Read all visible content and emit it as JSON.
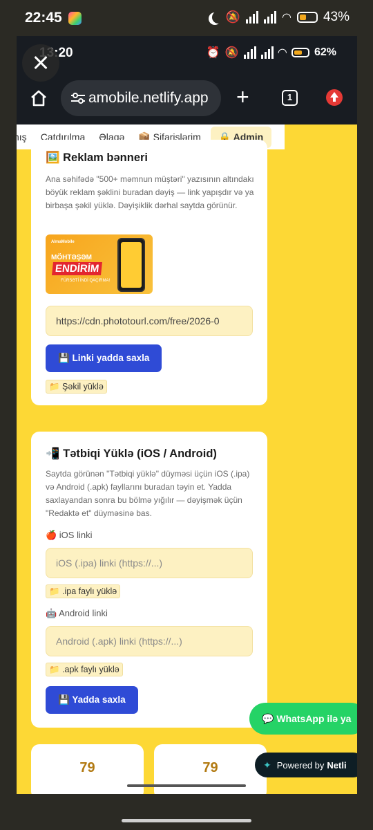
{
  "outer_status": {
    "time": "22:45",
    "battery": "43%"
  },
  "inner_status": {
    "time": "13:20",
    "battery": "62%"
  },
  "browser": {
    "url": "amobile.netlify.app",
    "tab_count": "1"
  },
  "nav": {
    "items": [
      "nış",
      "Çatdırılma",
      "Əlaqə",
      "📦 Sifarişlərim"
    ],
    "admin": "🔒 Admin"
  },
  "banner_card": {
    "title": "🖼️ Reklam bənneri",
    "description": "Ana səhifədə \"500+ məmnun müştəri\" yazısının altındakı böyük reklam şəklini buradan dəyiş — link yapışdır və ya birbaşa şəkil yüklə. Dəyişiklik dərhal saytda görünür.",
    "banner_image": {
      "brand": "AlmaMobile",
      "headline": "MÖHTƏŞƏM",
      "big_text": "ENDİRİM",
      "sub_text": "FÜRSƏTİ İNDİ QAÇIRMA!"
    },
    "url_value": "https://cdn.phototourl.com/free/2026-0",
    "save_link_button": "💾 Linki yadda saxla",
    "upload_button": "📁 Şəkil yüklə"
  },
  "app_card": {
    "title": "📲 Tətbiqi Yüklə (iOS / Android)",
    "description": "Saytda görünən \"Tətbiqi yüklə\" düyməsi üçün iOS (.ipa) və Android (.apk) fayllarını buradan təyin et. Yadda saxlayandan sonra bu bölmə yığılır — dəyişmək üçün \"Redaktə et\" düyməsinə bas.",
    "ios_label": "🍎 iOS linki",
    "ios_placeholder": "iOS (.ipa) linki (https://...)",
    "ios_upload": "📁 .ipa faylı yüklə",
    "android_label": "🤖 Android linki",
    "android_placeholder": "Android (.apk) linki (https://...)",
    "android_upload": "📁 .apk faylı yüklə",
    "save_button": "💾 Yadda saxla"
  },
  "stats": [
    "79",
    "79"
  ],
  "whatsapp": "💬 WhatsApp ilə ya",
  "netlify": {
    "prefix": "Powered by",
    "brand": "Netli"
  },
  "colors": {
    "page_bg": "#fdd835",
    "primary_button": "#2f4bd6",
    "input_bg": "#fdf1c2",
    "whatsapp": "#25d366"
  }
}
